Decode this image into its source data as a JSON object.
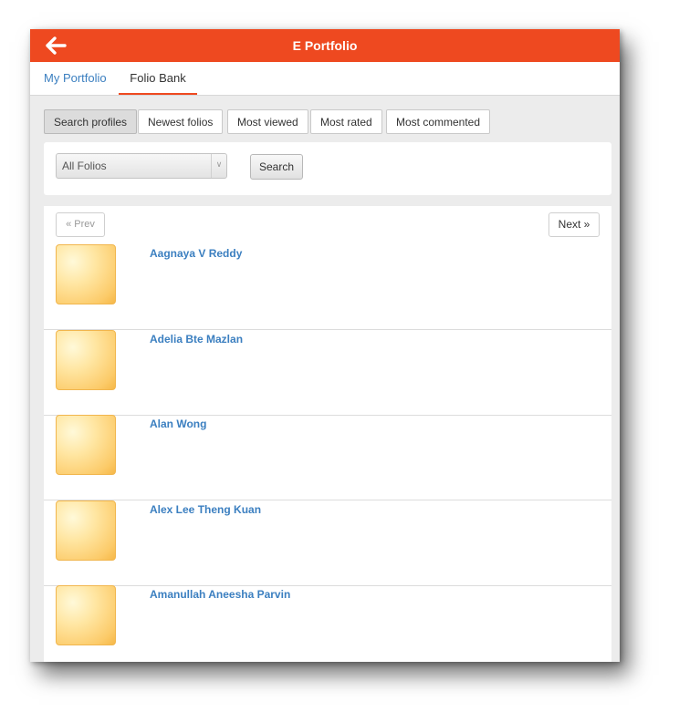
{
  "header": {
    "title": "E Portfolio",
    "back_icon": "arrow-left-icon",
    "color": "#ee4920"
  },
  "tabs": [
    {
      "label": "My Portfolio",
      "active": false
    },
    {
      "label": "Folio Bank",
      "active": true
    }
  ],
  "filters": [
    {
      "label": "Search profiles",
      "active": true
    },
    {
      "label": "Newest folios",
      "active": false
    },
    {
      "label": "Most viewed",
      "active": false
    },
    {
      "label": "Most rated",
      "active": false
    },
    {
      "label": "Most commented",
      "active": false
    }
  ],
  "search": {
    "select_value": "All Folios",
    "button_label": "Search"
  },
  "pager": {
    "prev_label": "« Prev",
    "next_label": "Next »"
  },
  "profiles": [
    {
      "name": "Aagnaya V Reddy"
    },
    {
      "name": "Adelia Bte Mazlan"
    },
    {
      "name": "Alan Wong"
    },
    {
      "name": "Alex Lee Theng Kuan"
    },
    {
      "name": "Amanullah Aneesha Parvin"
    }
  ],
  "colors": {
    "accent": "#ee4920",
    "link": "#3b7fc0"
  }
}
